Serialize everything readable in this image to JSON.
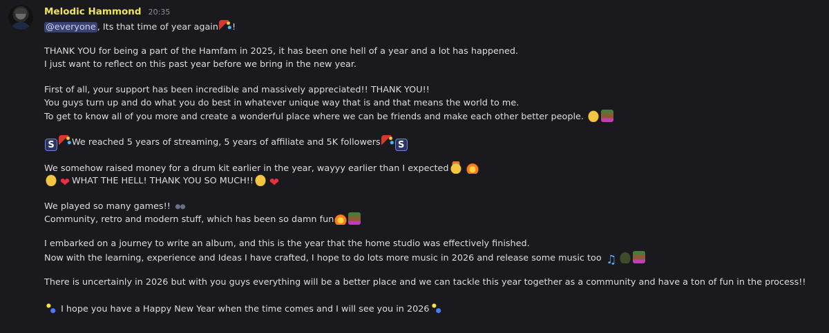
{
  "message": {
    "author": "Melodic Hammond",
    "timestamp": "20:35",
    "mention": "@everyone",
    "lines": {
      "l1": ", Its that time of year again",
      "l1_end": "!",
      "l2": "THANK YOU for being a part of the Hamfam in 2025, it has been one hell of a year and a lot has happened.",
      "l3": "I just want to reflect on this past year before we bring in the new year.",
      "l4": "First of all, your support has been incredible and massively appreciated!! THANK YOU!!",
      "l5": "You guys turn up and do what you do best in whatever unique way that is and that means the world to me.",
      "l6": "To get to know all of you more and create a wonderful place where we can be friends and make each other better people.",
      "l7": "We reached 5 years of streaming, 5 years of affiliate and 5K followers",
      "l8": "We somehow raised money for a drum kit earlier in the year, wayyy earlier than I expected",
      "l9": "WHAT THE HELL! THANK YOU SO MUCH!!",
      "l10": "We played so many games!!",
      "l11": "Community, retro and modern stuff, which has been so damn fun",
      "l12": "I embarked on a journey to write an album, and this is the year that the home studio was effectively finished.",
      "l13": "Now with the learning, experience and Ideas I have crafted, I hope to do lots more music in 2026 and release some music too",
      "l14": "There is uncertainly in 2026 but with you guys everything will be a better place and we can tackle this year together as a community and have a ton of fun in the process!!",
      "l15": "I hope you have a Happy New Year when the time comes and I will see you in 2026"
    },
    "emoji_s": "S",
    "heart_glyph": "❤",
    "note_glyph": "♫"
  },
  "colors": {
    "background": "#1a1a1e",
    "username": "#f0e35a",
    "text": "#dcdde1",
    "mention_bg": "#3c4270",
    "mention_text": "#c9cdfb"
  }
}
